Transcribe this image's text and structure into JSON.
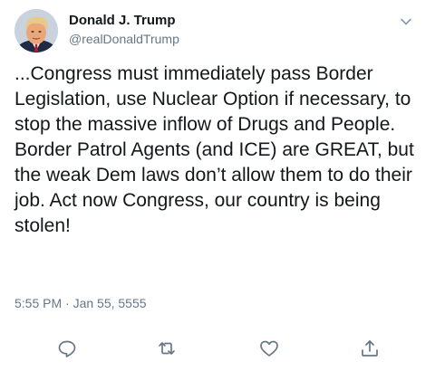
{
  "tweet": {
    "author": {
      "display_name": "Donald J. Trump",
      "handle": "@realDonaldTrump",
      "avatar": "avatar-photo"
    },
    "text": "...Congress must immediately pass Border Legislation, use Nuclear Option if necessary, to stop the massive inflow of Drugs and People. Border Patrol Agents (and ICE) are GREAT, but the weak Dem laws don’t allow them to do their job. Act now Congress, our country is being stolen!",
    "timestamp": "5:55 PM · Jan 55, 5555",
    "menu_icon": "chevron-down-icon",
    "actions": [
      {
        "name": "reply",
        "icon": "reply-icon"
      },
      {
        "name": "retweet",
        "icon": "retweet-icon"
      },
      {
        "name": "like",
        "icon": "heart-icon"
      },
      {
        "name": "share",
        "icon": "share-icon"
      }
    ]
  },
  "colors": {
    "text_primary": "#14171a",
    "text_secondary": "#657786",
    "icon": "#657786"
  }
}
